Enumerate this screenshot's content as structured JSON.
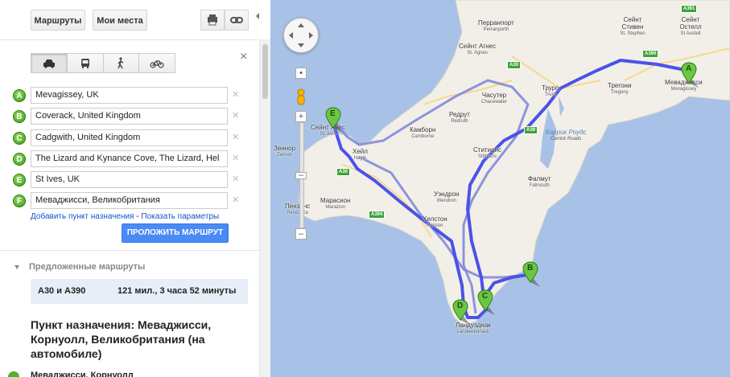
{
  "toolbar": {
    "routes_label": "Маршруты",
    "places_label": "Мои места"
  },
  "modes": [
    {
      "name": "car",
      "active": true
    },
    {
      "name": "transit",
      "active": false
    },
    {
      "name": "walk",
      "active": false
    },
    {
      "name": "bike",
      "active": false
    }
  ],
  "waypoints": [
    {
      "letter": "A",
      "value": "Mevagissey, UK"
    },
    {
      "letter": "B",
      "value": "Coverack, United Kingdom"
    },
    {
      "letter": "C",
      "value": "Cadgwith, United Kingdom"
    },
    {
      "letter": "D",
      "value": "The Lizard and Kynance Cove, The Lizard, Hel"
    },
    {
      "letter": "E",
      "value": "St Ives, UK"
    },
    {
      "letter": "F",
      "value": "Меваджисси, Великобритания"
    }
  ],
  "links": {
    "add_destination": "Добавить пункт назначения",
    "separator": " - ",
    "show_options": "Показать параметры"
  },
  "route_button_label": "ПРОЛОЖИТЬ МАРШРУТ",
  "suggested": {
    "header": "Предложенные маршруты",
    "routes": [
      {
        "name": "A30 и A390",
        "summary": "121 мил., 3 часа 52 минуты"
      }
    ]
  },
  "destination_title": "Пункт назначения: Меваджисси, Корнуолл, Великобритания (на автомобиле)",
  "start_line": "Меваджисси, Корнуолл",
  "map": {
    "colors": {
      "sea": "#a7c2e6",
      "land": "#f2efe9",
      "route": "#4a53e8",
      "route_alt": "#7c82d8"
    },
    "labels": [
      {
        "text": "Перранпорт",
        "sub": "Perranporth"
      },
      {
        "text": "Сейнт Агнес",
        "sub": "St. Agnes"
      },
      {
        "text": "Часутер",
        "sub": "Chacewater"
      },
      {
        "text": "Труро",
        "sub": "Truro"
      },
      {
        "text": "Редрут",
        "sub": "Redruth"
      },
      {
        "text": "Камборн",
        "sub": "Camborne"
      },
      {
        "text": "Сейнт Айвс",
        "sub": "St. Ives"
      },
      {
        "text": "Хейл",
        "sub": "Hayle"
      },
      {
        "text": "Зеннор",
        "sub": "Zennor"
      },
      {
        "text": "Марасион",
        "sub": "Marazion"
      },
      {
        "text": "Пензанс",
        "sub": "Penzance"
      },
      {
        "text": "Ститианс",
        "sub": "Stithians"
      },
      {
        "text": "Фалмут",
        "sub": "Falmouth"
      },
      {
        "text": "Уэндрон",
        "sub": "Wendron"
      },
      {
        "text": "Хелстон",
        "sub": "Helston"
      },
      {
        "text": "Трегони",
        "sub": "Tregony"
      },
      {
        "text": "Меваджисси",
        "sub": "Mevagissey"
      },
      {
        "text": "Сейнт Стивен",
        "sub": "St. Stephen"
      },
      {
        "text": "Сейнт Остелл",
        "sub": "St Austell"
      },
      {
        "text": "Ландуэднак",
        "sub": "Landewednack"
      }
    ],
    "sea_labels": [
      "Каррик Роудс",
      "Carrick Roads"
    ],
    "shields": [
      "A391",
      "A390",
      "A30",
      "A39",
      "A30",
      "A394"
    ],
    "markers": [
      "A",
      "B",
      "C",
      "D",
      "E"
    ]
  }
}
